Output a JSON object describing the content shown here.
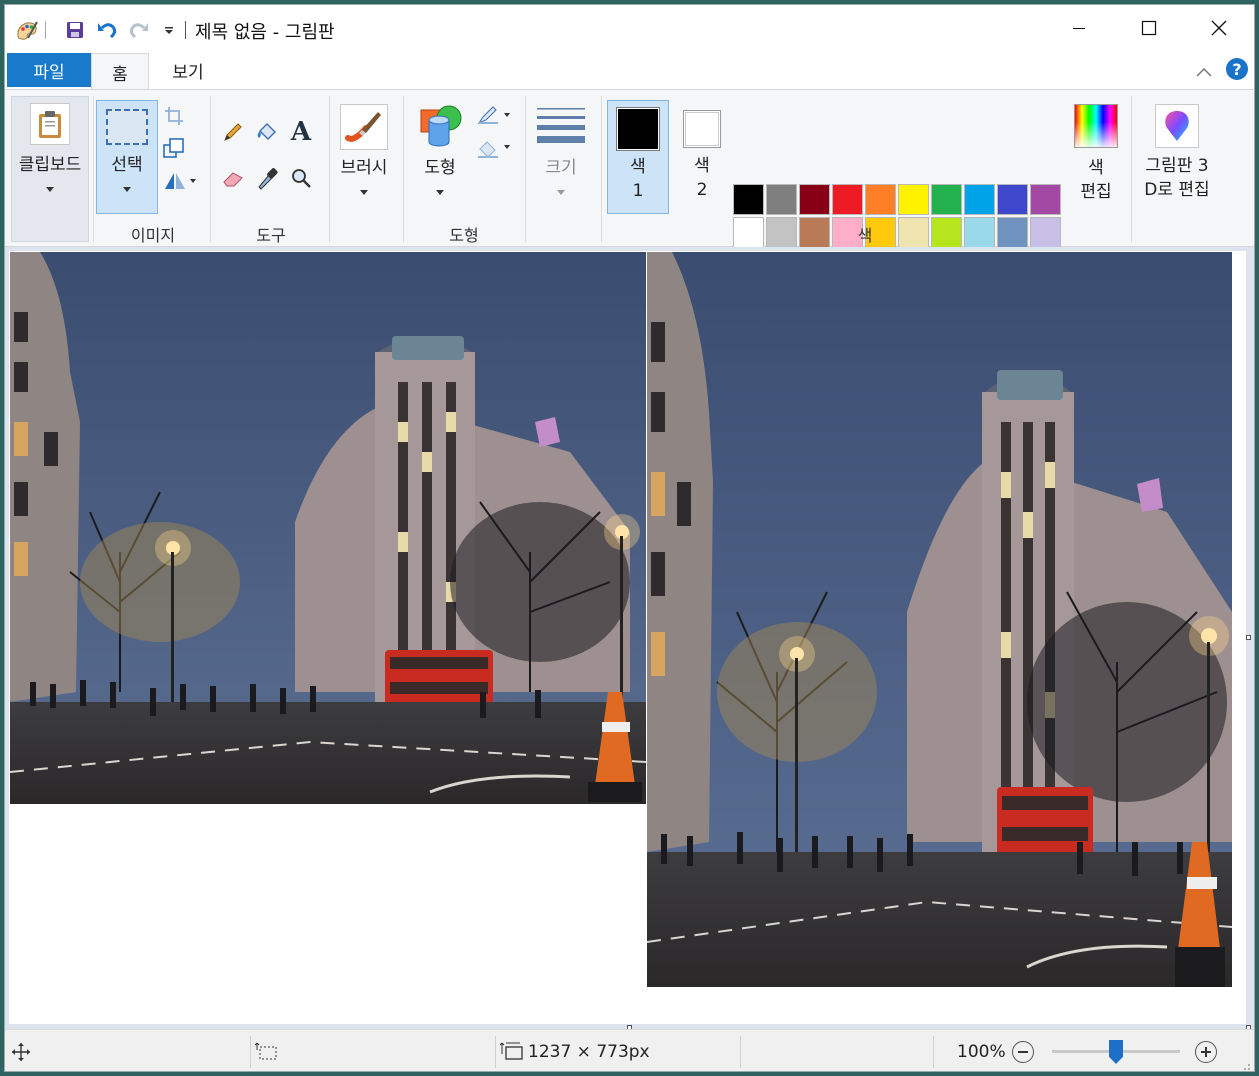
{
  "window": {
    "title": "제목 없음 - 그림판"
  },
  "tabs": {
    "file": "파일",
    "home": "홈",
    "view": "보기"
  },
  "ribbon": {
    "clipboard": {
      "label": "클립보드"
    },
    "image": {
      "group_label": "이미지",
      "select_label": "선택"
    },
    "tools": {
      "group_label": "도구"
    },
    "brushes": {
      "label": "브러시"
    },
    "shapes": {
      "label": "도형",
      "group_label": "도형"
    },
    "size": {
      "label": "크기"
    },
    "colors": {
      "group_label": "색",
      "color1_label_top": "색",
      "color1_label_bottom": "1",
      "color1_value": "#000000",
      "color2_label_top": "색",
      "color2_label_bottom": "2",
      "color2_value": "#ffffff",
      "palette_row1": [
        "#000000",
        "#7f7f7f",
        "#880015",
        "#ed1c24",
        "#ff7f27",
        "#fff200",
        "#22b14c",
        "#00a2e8",
        "#3f48cc",
        "#a349a4"
      ],
      "palette_row2": [
        "#ffffff",
        "#c3c3c3",
        "#b97a57",
        "#ffaec9",
        "#ffc90e",
        "#efe4b0",
        "#b5e61d",
        "#99d9ea",
        "#7092be",
        "#c8bfe7"
      ],
      "edit_label_top": "색",
      "edit_label_bottom": "편집"
    },
    "paint3d": {
      "label_top": "그림판 3",
      "label_bottom": "D로 편집"
    }
  },
  "status": {
    "canvas_size": "1237 × 773px",
    "zoom": "100%",
    "zoom_fraction": 0.5
  }
}
